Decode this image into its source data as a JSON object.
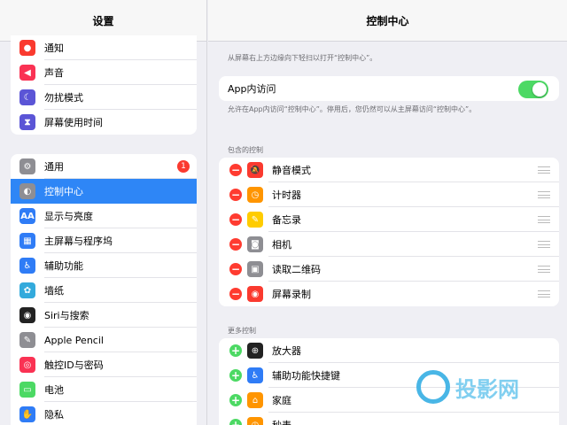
{
  "sidebar": {
    "title": "设置",
    "group1": [
      {
        "label": "通知",
        "icon": "notification-icon",
        "glyph": "●",
        "color": "#fa3a2f"
      },
      {
        "label": "声音",
        "icon": "sound-icon",
        "glyph": "◀",
        "color": "#fa3253"
      },
      {
        "label": "勿扰模式",
        "icon": "moon-icon",
        "glyph": "☾",
        "color": "#5b55d6"
      },
      {
        "label": "屏幕使用时间",
        "icon": "hourglass-icon",
        "glyph": "⧗",
        "color": "#5b55d6"
      }
    ],
    "group2": [
      {
        "label": "通用",
        "icon": "gear-icon",
        "glyph": "⚙",
        "color": "#8e8e93",
        "badge": "1"
      },
      {
        "label": "控制中心",
        "icon": "control-center-icon",
        "glyph": "◐",
        "color": "#8e8e93",
        "active": true
      },
      {
        "label": "显示与亮度",
        "icon": "display-icon",
        "glyph": "AA",
        "color": "#2f7cf6"
      },
      {
        "label": "主屏幕与程序坞",
        "icon": "home-screen-icon",
        "glyph": "▦",
        "color": "#2f7cf6"
      },
      {
        "label": "辅助功能",
        "icon": "accessibility-icon",
        "glyph": "♿",
        "color": "#2f7cf6"
      },
      {
        "label": "墙纸",
        "icon": "wallpaper-icon",
        "glyph": "✿",
        "color": "#33aadc"
      },
      {
        "label": "Siri与搜索",
        "icon": "siri-icon",
        "glyph": "◉",
        "color": "#222"
      },
      {
        "label": "Apple Pencil",
        "icon": "pencil-icon",
        "glyph": "✎",
        "color": "#8e8e93"
      },
      {
        "label": "触控ID与密码",
        "icon": "fingerprint-icon",
        "glyph": "◎",
        "color": "#fa3253"
      },
      {
        "label": "电池",
        "icon": "battery-icon",
        "glyph": "▭",
        "color": "#4cd964"
      },
      {
        "label": "隐私",
        "icon": "hand-icon",
        "glyph": "✋",
        "color": "#2f7cf6"
      }
    ]
  },
  "main": {
    "title": "控制中心",
    "intro": "从屏幕右上方边缘向下轻扫以打开“控制中心”。",
    "app_access_label": "App内访问",
    "app_access_note": "允许在App内访问“控制中心”。停用后，您仍然可以从主屏幕访问“控制中心”。",
    "included_title": "包含的控制",
    "included": [
      {
        "label": "静音模式",
        "icon": "bell-mute-icon",
        "glyph": "🔕",
        "color": "#fa3a2f"
      },
      {
        "label": "计时器",
        "icon": "timer-icon",
        "glyph": "◷",
        "color": "#ff9500"
      },
      {
        "label": "备忘录",
        "icon": "notes-icon",
        "glyph": "✎",
        "color": "#ffcc00"
      },
      {
        "label": "相机",
        "icon": "camera-icon",
        "glyph": "◙",
        "color": "#8e8e93"
      },
      {
        "label": "读取二维码",
        "icon": "qr-code-icon",
        "glyph": "▣",
        "color": "#8e8e93"
      },
      {
        "label": "屏幕录制",
        "icon": "record-icon",
        "glyph": "◉",
        "color": "#fa3a2f"
      }
    ],
    "more_title": "更多控制",
    "more": [
      {
        "label": "放大器",
        "icon": "magnifier-icon",
        "glyph": "⊕",
        "color": "#222"
      },
      {
        "label": "辅助功能快捷键",
        "icon": "accessibility-shortcut-icon",
        "glyph": "♿",
        "color": "#2f7cf6"
      },
      {
        "label": "家庭",
        "icon": "home-icon",
        "glyph": "⌂",
        "color": "#ff9500"
      },
      {
        "label": "秒表",
        "icon": "stopwatch-icon",
        "glyph": "◷",
        "color": "#ff9500"
      }
    ]
  },
  "watermark": {
    "text": "投影网"
  }
}
